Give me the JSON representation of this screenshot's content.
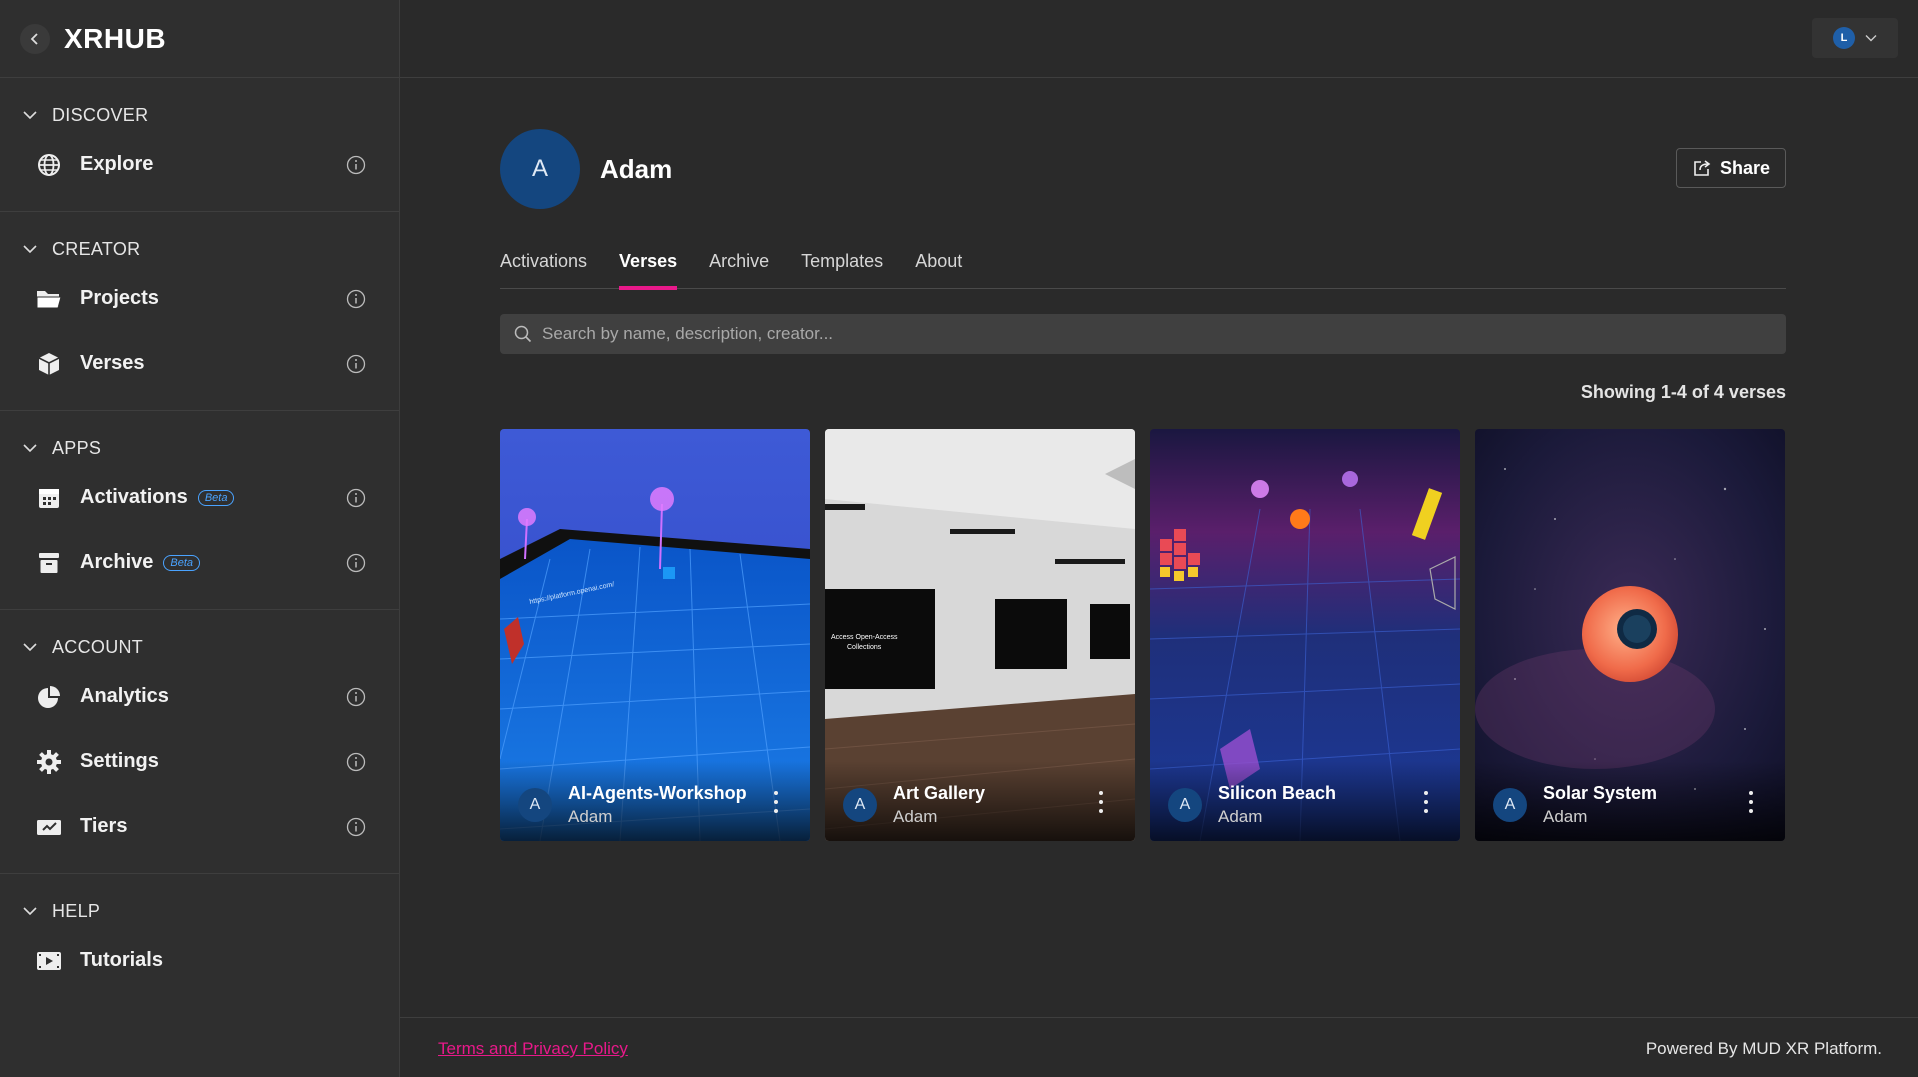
{
  "brand": {
    "title": "XRHUB",
    "back_icon": "chevron-left-icon"
  },
  "sidebar": {
    "sections": [
      {
        "title": "DISCOVER",
        "items": [
          {
            "label": "Explore",
            "icon": "globe-icon"
          }
        ]
      },
      {
        "title": "CREATOR",
        "items": [
          {
            "label": "Projects",
            "icon": "folder-icon"
          },
          {
            "label": "Verses",
            "icon": "cube-icon"
          }
        ]
      },
      {
        "title": "APPS",
        "items": [
          {
            "label": "Activations",
            "icon": "calendar-icon",
            "badge": "Beta"
          },
          {
            "label": "Archive",
            "icon": "archive-icon",
            "badge": "Beta"
          }
        ]
      },
      {
        "title": "ACCOUNT",
        "items": [
          {
            "label": "Analytics",
            "icon": "pie-chart-icon"
          },
          {
            "label": "Settings",
            "icon": "gear-icon"
          },
          {
            "label": "Tiers",
            "icon": "ticket-icon"
          }
        ]
      },
      {
        "title": "HELP",
        "items": [
          {
            "label": "Tutorials",
            "icon": "video-icon"
          }
        ]
      }
    ]
  },
  "topbar": {
    "user_initial": "L"
  },
  "profile": {
    "initial": "A",
    "name": "Adam",
    "share_label": "Share"
  },
  "tabs": [
    {
      "label": "Activations",
      "active": false
    },
    {
      "label": "Verses",
      "active": true
    },
    {
      "label": "Archive",
      "active": false
    },
    {
      "label": "Templates",
      "active": false
    },
    {
      "label": "About",
      "active": false
    }
  ],
  "search": {
    "placeholder": "Search by name, description, creator...",
    "value": ""
  },
  "results": {
    "showing": "Showing 1-4 of 4 verses"
  },
  "cards": [
    {
      "title": "AI-Agents-Workshop",
      "creator": "Adam",
      "initial": "A",
      "thumb_caption": "https://platform.openai.com/"
    },
    {
      "title": "Art Gallery",
      "creator": "Adam",
      "initial": "A"
    },
    {
      "title": "Silicon Beach",
      "creator": "Adam",
      "initial": "A"
    },
    {
      "title": "Solar System",
      "creator": "Adam",
      "initial": "A"
    }
  ],
  "footer": {
    "link": "Terms and Privacy Policy",
    "powered": "Powered By MUD XR Platform."
  },
  "colors": {
    "accent": "#e8198a",
    "avatar_bg": "#14467f",
    "beta": "#4aa3ff"
  }
}
